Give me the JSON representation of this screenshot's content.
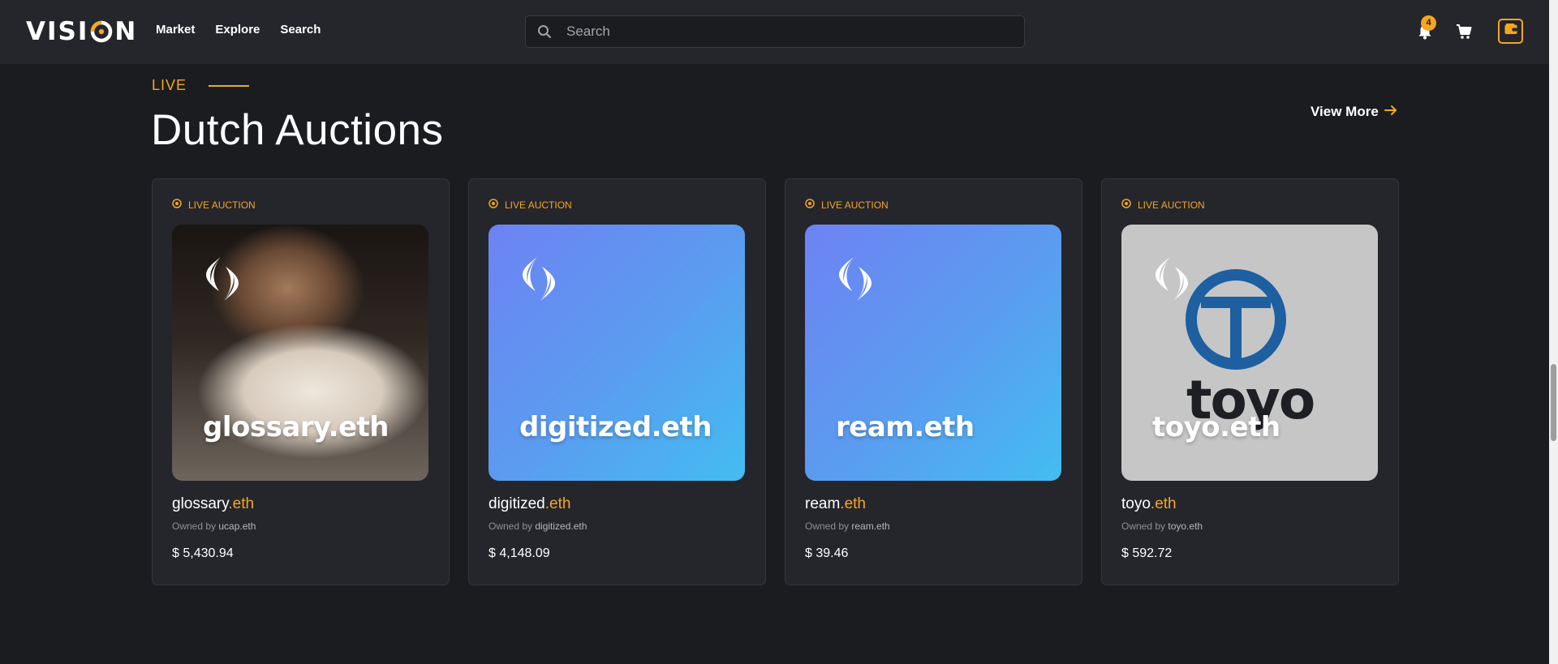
{
  "header": {
    "logo_text_left": "VISI",
    "logo_text_right": "N",
    "nav": [
      "Market",
      "Explore",
      "Search"
    ],
    "search_placeholder": "Search",
    "notification_count": "4",
    "accent_color": "#f5a623"
  },
  "section": {
    "eyebrow": "LIVE",
    "title": "Dutch Auctions",
    "view_more": "View More"
  },
  "cards": [
    {
      "badge": "LIVE AUCTION",
      "image_label": "glossary.eth",
      "name": "glossary",
      "suffix": ".eth",
      "owner_prefix": "Owned by",
      "owner": "ucap.eth",
      "price": "$ 5,430.94"
    },
    {
      "badge": "LIVE AUCTION",
      "image_label": "digitized.eth",
      "name": "digitized",
      "suffix": ".eth",
      "owner_prefix": "Owned by",
      "owner": "digitized.eth",
      "price": "$ 4,148.09"
    },
    {
      "badge": "LIVE AUCTION",
      "image_label": "ream.eth",
      "name": "ream",
      "suffix": ".eth",
      "owner_prefix": "Owned by",
      "owner": "ream.eth",
      "price": "$ 39.46"
    },
    {
      "badge": "LIVE AUCTION",
      "image_label": "toyo.eth",
      "image_logo_text": "toyo",
      "name": "toyo",
      "suffix": ".eth",
      "owner_prefix": "Owned by",
      "owner": "toyo.eth",
      "price": "$ 592.72"
    }
  ]
}
